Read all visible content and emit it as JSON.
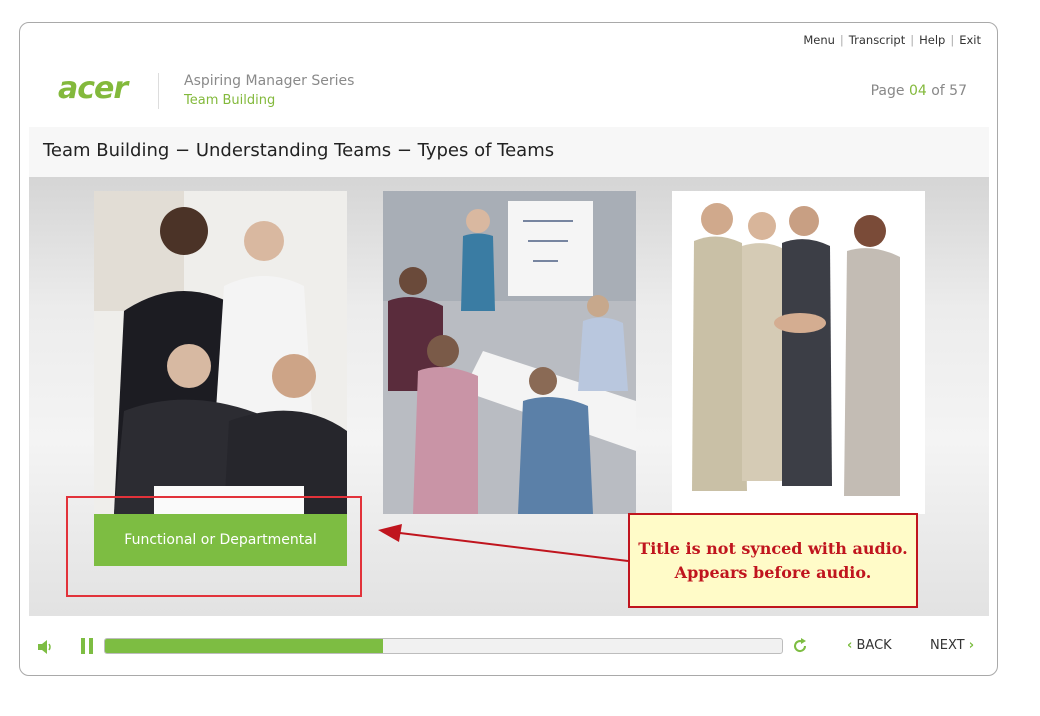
{
  "header": {
    "nav": [
      "Menu",
      "Transcript",
      "Help",
      "Exit"
    ],
    "logo_text": "acer",
    "series_title": "Aspiring Manager Series",
    "series_subtitle": "Team Building",
    "page_label": "Page",
    "page_current": "04",
    "page_of": "of",
    "page_total": "57"
  },
  "content": {
    "title": "Team Building − Understanding Teams − Types of Teams",
    "caption_1": "Functional or Departmental",
    "annotation_line1": "Title is not synced with audio.",
    "annotation_line2": "Appears before audio."
  },
  "controls": {
    "back_label": "BACK",
    "next_label": "NEXT",
    "progress_fraction": 0.41
  },
  "colors": {
    "accent": "#7dbd42",
    "annotation_red": "#c0151e",
    "annotation_bg": "#fffbc8"
  }
}
